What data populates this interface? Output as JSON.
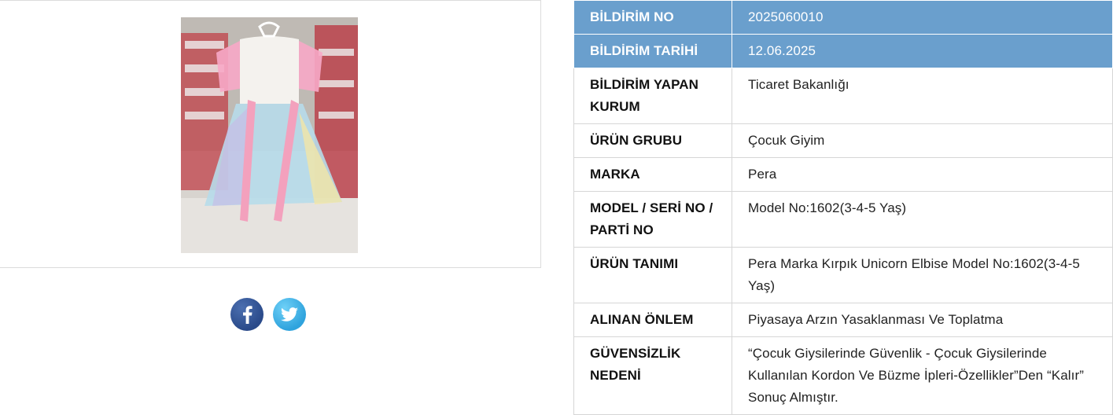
{
  "product_image": {
    "alt_icon": "dress-photo"
  },
  "share": {
    "facebook_icon": "facebook-icon",
    "twitter_icon": "twitter-icon",
    "colors": {
      "facebook": "#2a4a8a",
      "twitter": "#2fa3dd"
    }
  },
  "table": {
    "header_color": "#6a9fcd",
    "rows": [
      {
        "label": "BİLDİRİM NO",
        "value": "2025060010"
      },
      {
        "label": "BİLDİRİM TARİHİ",
        "value": "12.06.2025"
      },
      {
        "label": "BİLDİRİM YAPAN KURUM",
        "value": "Ticaret Bakanlığı"
      },
      {
        "label": "ÜRÜN GRUBU",
        "value": "Çocuk Giyim"
      },
      {
        "label": "MARKA",
        "value": "Pera"
      },
      {
        "label": "MODEL / SERİ NO / PARTİ NO",
        "value": "Model No:1602(3-4-5 Yaş)"
      },
      {
        "label": "ÜRÜN TANIMI",
        "value": "Pera Marka Kırpık Unicorn Elbise Model No:1602(3-4-5 Yaş)"
      },
      {
        "label": "ALINAN ÖNLEM",
        "value": "Piyasaya Arzın Yasaklanması Ve Toplatma"
      },
      {
        "label": "GÜVENSİZLİK NEDENİ",
        "value": "“Çocuk Giysilerinde Güvenlik - Çocuk Giysilerinde Kullanılan Kordon Ve Büzme İpleri-Özellikler”Den “Kalır” Sonuç Almıştır."
      }
    ]
  }
}
